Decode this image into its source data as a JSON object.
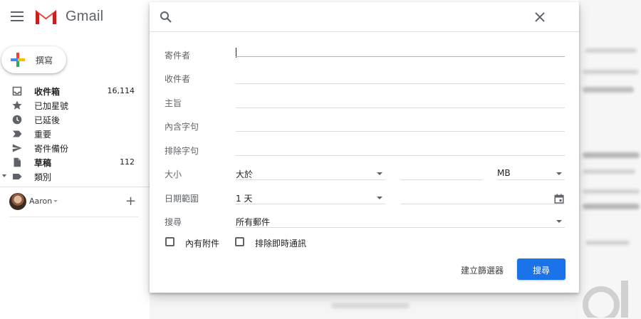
{
  "app": {
    "name": "Gmail",
    "brand_color": "#ea4335"
  },
  "compose": {
    "label": "撰寫"
  },
  "nav": {
    "items": [
      {
        "icon": "inbox-icon",
        "label": "收件箱",
        "count": "16,114",
        "bold": true
      },
      {
        "icon": "star-icon",
        "label": "已加星號",
        "count": ""
      },
      {
        "icon": "clock-icon",
        "label": "已延後",
        "count": ""
      },
      {
        "icon": "important-icon",
        "label": "重要",
        "count": ""
      },
      {
        "icon": "send-icon",
        "label": "寄件備份",
        "count": ""
      },
      {
        "icon": "draft-icon",
        "label": "草稿",
        "count": "112",
        "bold": true
      },
      {
        "icon": "label-icon",
        "label": "類別",
        "count": ""
      }
    ]
  },
  "account": {
    "name": "Aaron"
  },
  "search_dialog": {
    "search": {
      "value": "",
      "placeholder": ""
    },
    "fields": {
      "from": {
        "label": "寄件者",
        "value": ""
      },
      "to": {
        "label": "收件者",
        "value": ""
      },
      "subject": {
        "label": "主旨",
        "value": ""
      },
      "has_words": {
        "label": "內含字句",
        "value": ""
      },
      "exclude_words": {
        "label": "排除字句",
        "value": ""
      }
    },
    "size": {
      "label": "大小",
      "operator": "大於",
      "value": "",
      "unit": "MB"
    },
    "date_range": {
      "label": "日期範圍",
      "period": "1 天",
      "value": ""
    },
    "search_in": {
      "label": "搜尋",
      "value": "所有郵件"
    },
    "has_attachment": {
      "label": "內有附件",
      "checked": false
    },
    "exclude_chats": {
      "label": "排除即時通訊",
      "checked": false
    },
    "create_filter_label": "建立篩選器",
    "search_button_label": "搜尋",
    "accent_color": "#1a73e8"
  }
}
